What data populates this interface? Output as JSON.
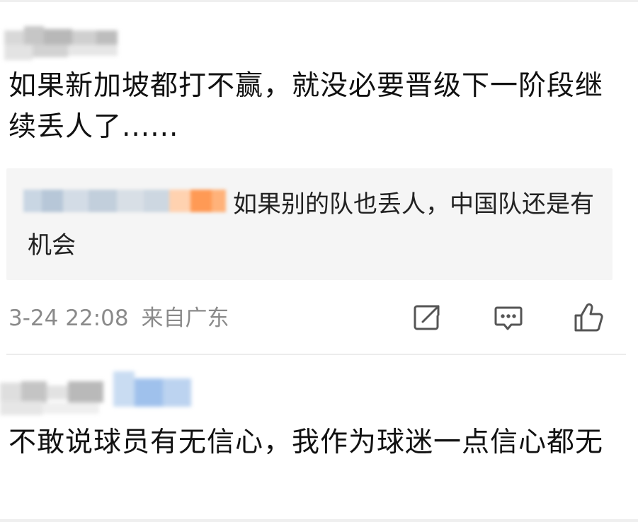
{
  "comments": [
    {
      "text": "如果新加坡都打不赢，就没必要晋级下一阶段继续丢人了......",
      "reply": {
        "text": "如果别的队也丢人，中国队还是有机会"
      },
      "meta": {
        "time": "3-24 22:08",
        "location": "来自广东"
      },
      "actions": [
        {
          "icon": "share-icon"
        },
        {
          "icon": "comment-icon"
        },
        {
          "icon": "like-icon"
        }
      ]
    },
    {
      "text": "不敢说球员有无信心，我作为球迷一点信心都无"
    }
  ],
  "colors": {
    "meta_gray": "#8a8a8a",
    "reply_bg": "#f5f5f5",
    "icon_gray": "#555555"
  }
}
